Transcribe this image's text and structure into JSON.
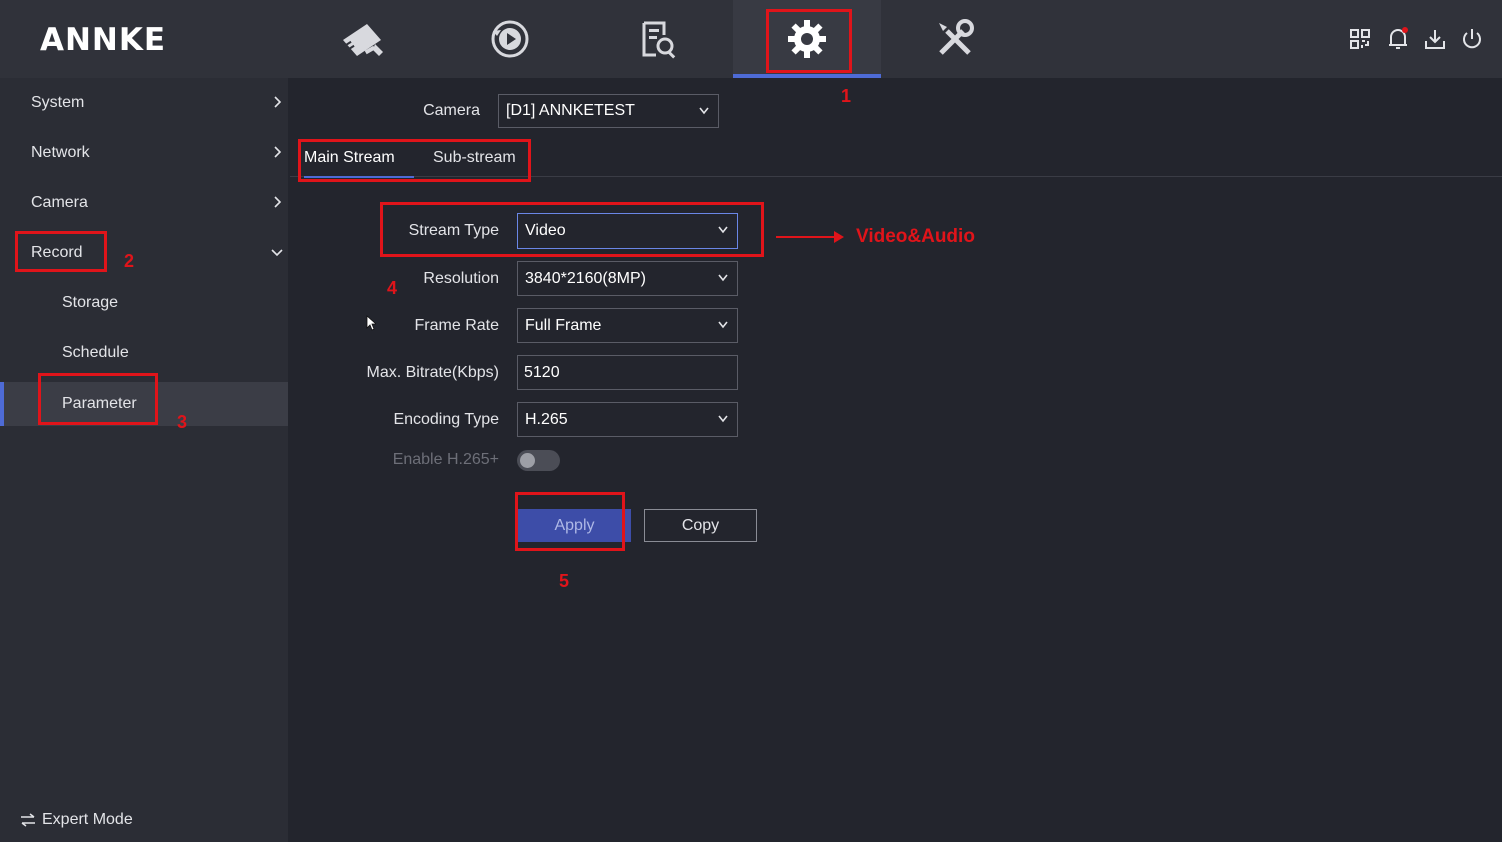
{
  "header": {
    "logo": "ANNKE",
    "nav_icons": [
      "camera-icon",
      "playback-icon",
      "search-file-icon",
      "settings-gear-icon",
      "tools-icon"
    ],
    "right_icons": [
      "qr-code-icon",
      "notification-bell-icon",
      "download-icon",
      "power-icon"
    ]
  },
  "sidebar": {
    "items": [
      {
        "label": "System"
      },
      {
        "label": "Network"
      },
      {
        "label": "Camera"
      },
      {
        "label": "Record"
      }
    ],
    "sub_items": [
      {
        "label": "Storage"
      },
      {
        "label": "Schedule"
      },
      {
        "label": "Parameter"
      }
    ],
    "expert_mode": "Expert Mode"
  },
  "main": {
    "camera_label": "Camera",
    "camera_value": "[D1] ANNKETEST",
    "tabs": [
      {
        "label": "Main Stream"
      },
      {
        "label": "Sub-stream"
      }
    ],
    "fields": {
      "stream_type": {
        "label": "Stream Type",
        "value": "Video"
      },
      "resolution": {
        "label": "Resolution",
        "value": "3840*2160(8MP)"
      },
      "frame_rate": {
        "label": "Frame Rate",
        "value": "Full Frame"
      },
      "max_bitrate": {
        "label": "Max. Bitrate(Kbps)",
        "value": "5120"
      },
      "encoding_type": {
        "label": "Encoding Type",
        "value": "H.265"
      },
      "enable_h265plus": {
        "label": "Enable H.265+",
        "on": false
      }
    },
    "apply_label": "Apply",
    "copy_label": "Copy"
  },
  "annotations": {
    "numbers": [
      "1",
      "2",
      "3",
      "4",
      "5"
    ],
    "note": "Video&Audio",
    "color": "#e0141a"
  }
}
